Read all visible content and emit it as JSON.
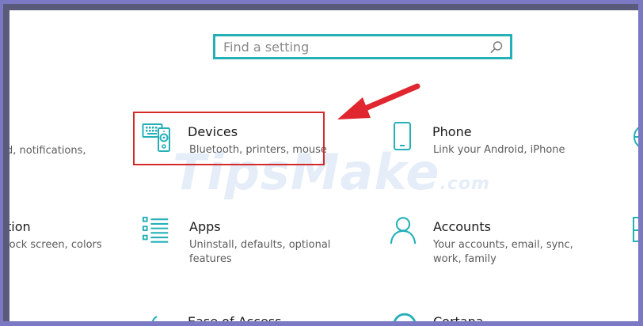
{
  "search": {
    "placeholder": "Find a setting"
  },
  "tiles": {
    "left_partial_1": {
      "desc": "d, notifications,"
    },
    "left_partial_2": {
      "title": "tion",
      "desc": "lock screen, colors"
    },
    "devices": {
      "title": "Devices",
      "desc": "Bluetooth, printers, mouse"
    },
    "phone": {
      "title": "Phone",
      "desc": "Link your Android, iPhone"
    },
    "apps": {
      "title": "Apps",
      "desc_line1": "Uninstall, defaults, optional",
      "desc_line2": "features"
    },
    "accounts": {
      "title": "Accounts",
      "desc_line1": "Your accounts, email, sync,",
      "desc_line2": "work, family"
    },
    "ease_of_access": {
      "title": "Ease of Access"
    },
    "cortana": {
      "title": "Cortana"
    }
  },
  "watermark": {
    "brand": "TipsMake",
    "suffix": ".com"
  },
  "colors": {
    "accent": "#25b0b8",
    "highlight": "#d42a2a",
    "arrow": "#e0262e"
  }
}
